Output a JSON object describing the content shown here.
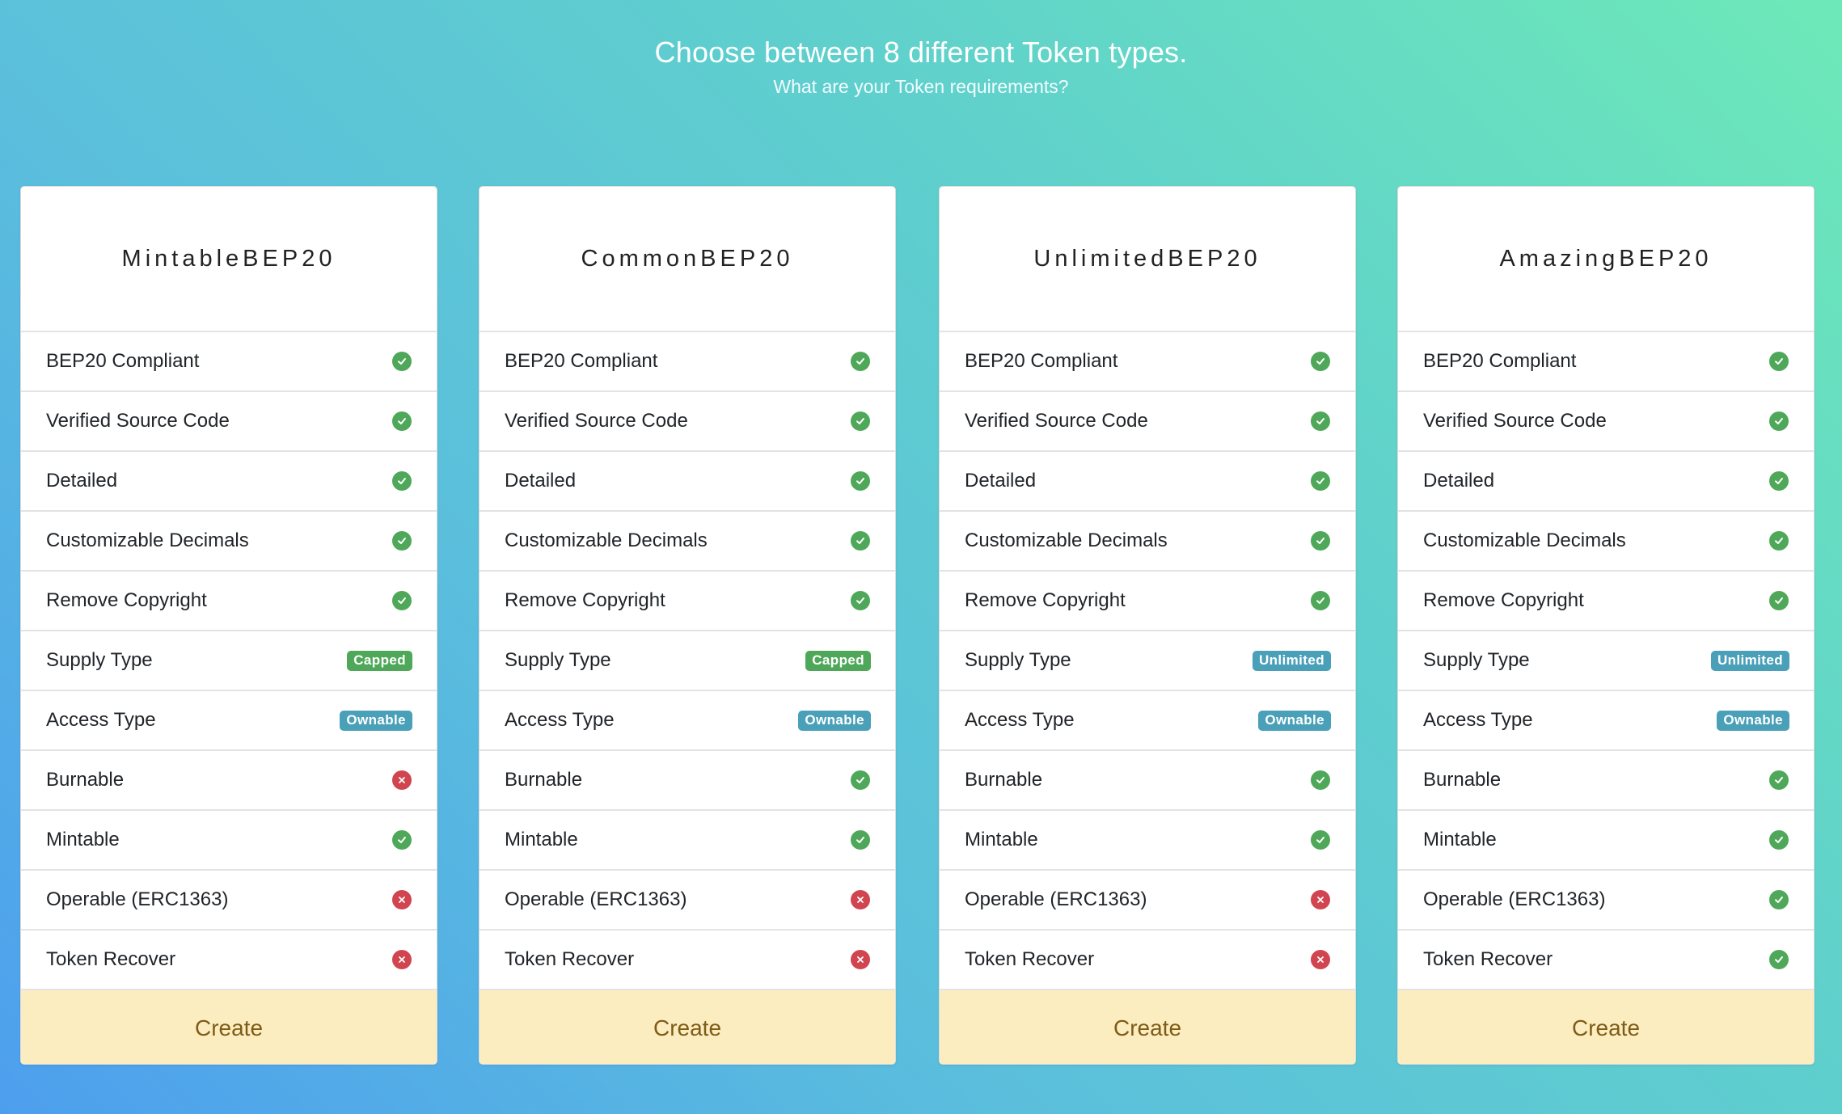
{
  "hero": {
    "title": "Choose between 8 different Token types.",
    "subtitle": "What are your Token requirements?"
  },
  "colors": {
    "check": "#4fa85a",
    "cross": "#d0454f",
    "badge_capped": "#4fa85a",
    "badge_info": "#4aa0b8",
    "footer_bg": "#fcedc1",
    "footer_text": "#7e5c17"
  },
  "cards": [
    {
      "name": "MintableBEP20",
      "create_label": "Create",
      "features": [
        {
          "label": "BEP20 Compliant",
          "type": "check",
          "value": true
        },
        {
          "label": "Verified Source Code",
          "type": "check",
          "value": true
        },
        {
          "label": "Detailed",
          "type": "check",
          "value": true
        },
        {
          "label": "Customizable Decimals",
          "type": "check",
          "value": true
        },
        {
          "label": "Remove Copyright",
          "type": "check",
          "value": true
        },
        {
          "label": "Supply Type",
          "type": "badge",
          "badge": "Capped",
          "style": "capped"
        },
        {
          "label": "Access Type",
          "type": "badge",
          "badge": "Ownable",
          "style": "info"
        },
        {
          "label": "Burnable",
          "type": "check",
          "value": false
        },
        {
          "label": "Mintable",
          "type": "check",
          "value": true
        },
        {
          "label": "Operable (ERC1363)",
          "type": "check",
          "value": false
        },
        {
          "label": "Token Recover",
          "type": "check",
          "value": false
        }
      ]
    },
    {
      "name": "CommonBEP20",
      "create_label": "Create",
      "features": [
        {
          "label": "BEP20 Compliant",
          "type": "check",
          "value": true
        },
        {
          "label": "Verified Source Code",
          "type": "check",
          "value": true
        },
        {
          "label": "Detailed",
          "type": "check",
          "value": true
        },
        {
          "label": "Customizable Decimals",
          "type": "check",
          "value": true
        },
        {
          "label": "Remove Copyright",
          "type": "check",
          "value": true
        },
        {
          "label": "Supply Type",
          "type": "badge",
          "badge": "Capped",
          "style": "capped"
        },
        {
          "label": "Access Type",
          "type": "badge",
          "badge": "Ownable",
          "style": "info"
        },
        {
          "label": "Burnable",
          "type": "check",
          "value": true
        },
        {
          "label": "Mintable",
          "type": "check",
          "value": true
        },
        {
          "label": "Operable (ERC1363)",
          "type": "check",
          "value": false
        },
        {
          "label": "Token Recover",
          "type": "check",
          "value": false
        }
      ]
    },
    {
      "name": "UnlimitedBEP20",
      "create_label": "Create",
      "features": [
        {
          "label": "BEP20 Compliant",
          "type": "check",
          "value": true
        },
        {
          "label": "Verified Source Code",
          "type": "check",
          "value": true
        },
        {
          "label": "Detailed",
          "type": "check",
          "value": true
        },
        {
          "label": "Customizable Decimals",
          "type": "check",
          "value": true
        },
        {
          "label": "Remove Copyright",
          "type": "check",
          "value": true
        },
        {
          "label": "Supply Type",
          "type": "badge",
          "badge": "Unlimited",
          "style": "info"
        },
        {
          "label": "Access Type",
          "type": "badge",
          "badge": "Ownable",
          "style": "info"
        },
        {
          "label": "Burnable",
          "type": "check",
          "value": true
        },
        {
          "label": "Mintable",
          "type": "check",
          "value": true
        },
        {
          "label": "Operable (ERC1363)",
          "type": "check",
          "value": false
        },
        {
          "label": "Token Recover",
          "type": "check",
          "value": false
        }
      ]
    },
    {
      "name": "AmazingBEP20",
      "create_label": "Create",
      "features": [
        {
          "label": "BEP20 Compliant",
          "type": "check",
          "value": true
        },
        {
          "label": "Verified Source Code",
          "type": "check",
          "value": true
        },
        {
          "label": "Detailed",
          "type": "check",
          "value": true
        },
        {
          "label": "Customizable Decimals",
          "type": "check",
          "value": true
        },
        {
          "label": "Remove Copyright",
          "type": "check",
          "value": true
        },
        {
          "label": "Supply Type",
          "type": "badge",
          "badge": "Unlimited",
          "style": "info"
        },
        {
          "label": "Access Type",
          "type": "badge",
          "badge": "Ownable",
          "style": "info"
        },
        {
          "label": "Burnable",
          "type": "check",
          "value": true
        },
        {
          "label": "Mintable",
          "type": "check",
          "value": true
        },
        {
          "label": "Operable (ERC1363)",
          "type": "check",
          "value": true
        },
        {
          "label": "Token Recover",
          "type": "check",
          "value": true
        }
      ]
    }
  ]
}
